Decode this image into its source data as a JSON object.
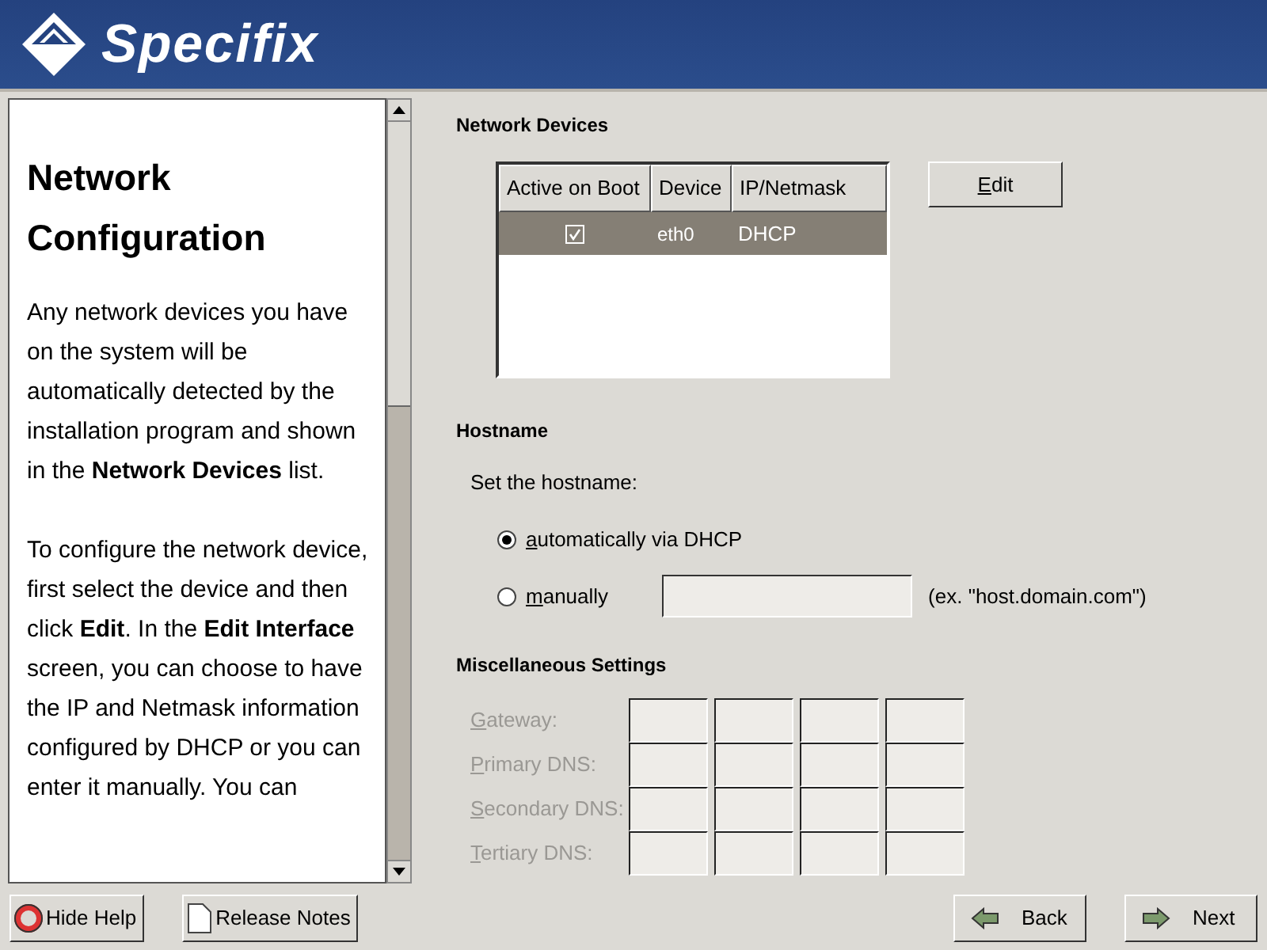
{
  "header": {
    "logo_text": "Specifix"
  },
  "help": {
    "title": "Network Configuration",
    "paragraphs": [
      "Any network devices you have on the system will be automatically detected by the installation program and shown in the **Network Devices** list.",
      "To configure the network device, first select the device and then click **Edit**. In the **Edit Interface** screen, you can choose to have the IP and Netmask information configured by DHCP or you can enter it manually. You can"
    ]
  },
  "network_devices": {
    "heading": "Network Devices",
    "columns": [
      "Active on Boot",
      "Device",
      "IP/Netmask"
    ],
    "rows": [
      {
        "active_on_boot": true,
        "device": "eth0",
        "ip_netmask": "DHCP",
        "selected": true
      }
    ],
    "edit_button": "Edit"
  },
  "hostname": {
    "heading": "Hostname",
    "prompt": "Set the hostname:",
    "options": [
      {
        "label": "automatically via DHCP",
        "selected": true,
        "kind": "plain"
      },
      {
        "label": "manually",
        "selected": false,
        "kind": "entry",
        "hint": "(ex. \"host.domain.com\")"
      }
    ]
  },
  "misc": {
    "heading": "Miscellaneous Settings",
    "disabled": true,
    "fields": [
      {
        "label": "Gateway:"
      },
      {
        "label": "Primary DNS:"
      },
      {
        "label": "Secondary DNS:"
      },
      {
        "label": "Tertiary DNS:"
      }
    ]
  },
  "buttons": [
    {
      "label": "Hide Help",
      "kind": "help"
    },
    {
      "label": "Release Notes",
      "kind": "notes"
    },
    {
      "label": "Back",
      "kind": "back"
    },
    {
      "label": "Next",
      "kind": "next"
    }
  ]
}
